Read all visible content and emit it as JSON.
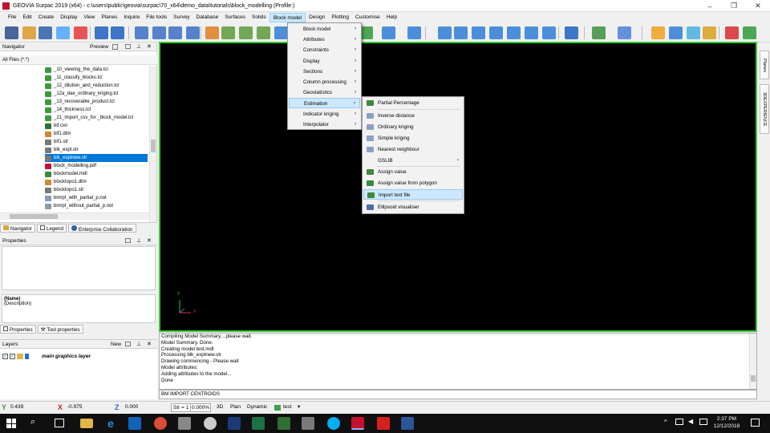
{
  "window": {
    "title": "GEOVIA Surpac 2019 (x64) - c:\\users\\public\\geovia\\surpac\\70_x64\\demo_data\\tutorials\\block_modelling (Profile:)",
    "minimize": "–",
    "maximize": "❐",
    "close": "✕"
  },
  "menubar": [
    "File",
    "Edit",
    "Create",
    "Display",
    "View",
    "Planes",
    "Inquire",
    "File tools",
    "Survey",
    "Database",
    "Surfaces",
    "Solids",
    "Block model",
    "Design",
    "Plotting",
    "Customise",
    "Help"
  ],
  "navigator": {
    "title": "Navigator",
    "preview_label": "Preview",
    "filter": "All Files (*.*)",
    "items": [
      {
        "label": "_10_viewing_the_data.tcl",
        "icon": "tcl-script-icon",
        "selected": false
      },
      {
        "label": "_11_classify_blocks.tcl",
        "icon": "tcl-script-icon",
        "selected": false
      },
      {
        "label": "_12_dilution_and_reduction.tcl",
        "icon": "tcl-script-icon",
        "selected": false
      },
      {
        "label": "_12a_dae_ordinary_kriging.tcl",
        "icon": "tcl-script-icon",
        "selected": false
      },
      {
        "label": "_13_recoverable_product.tcl",
        "icon": "tcl-script-icon",
        "selected": false
      },
      {
        "label": "_14_thickness.tcl",
        "icon": "tcl-script-icon",
        "selected": false
      },
      {
        "label": "_21_import_csv_for _block_model.tcl",
        "icon": "tcl-script-icon",
        "selected": false
      },
      {
        "label": "bif.cxn",
        "icon": "grid-icon",
        "selected": false
      },
      {
        "label": "bif1.dtm",
        "icon": "dtm-icon",
        "selected": false
      },
      {
        "label": "bif1.str",
        "icon": "string-icon",
        "selected": false
      },
      {
        "label": "blk_expt.str",
        "icon": "string-icon",
        "selected": false
      },
      {
        "label": "blk_exptnew.str",
        "icon": "string-icon",
        "selected": true
      },
      {
        "label": "block_modelling.pdf",
        "icon": "pdf-icon",
        "selected": false
      },
      {
        "label": "blockmodel.mdl",
        "icon": "model-icon",
        "selected": false
      },
      {
        "label": "blocktopo1.dtm",
        "icon": "dtm-icon",
        "selected": false
      },
      {
        "label": "blocktopo1.str",
        "icon": "string-icon",
        "selected": false
      },
      {
        "label": "bmrpt_with_partial_p.not",
        "icon": "report-icon",
        "selected": false
      },
      {
        "label": "bmrpt_without_partial_p.not",
        "icon": "report-icon",
        "selected": false
      }
    ],
    "tabs": [
      "Navigator",
      "Legend",
      "Enterprise Collaboration"
    ]
  },
  "properties": {
    "title": "Properties",
    "name_label": "(Name)",
    "desc_label": "(Description)",
    "tabs": [
      "Properties",
      "Tool properties"
    ]
  },
  "layers": {
    "title": "Layers",
    "new_label": "New",
    "layer_name": "main graphics layer"
  },
  "right_tabs": [
    "Planes",
    "3DEXPERIENCE"
  ],
  "viewport": {
    "axis_y": "Y",
    "axis_x": "X"
  },
  "output_lines": [
    "Compiling Model Summary....please wait.",
    "Model Summary. Done.",
    "Creating model test.mdl",
    "Processing blk_exptnew.str",
    "Drawing commencing - Please wait",
    "Model attributes:",
    "Adding attributes to the model...",
    "Done"
  ],
  "command_line": "BM IMPORT CENTROIDS",
  "status": {
    "y_label": "Y",
    "y_value": "0.439",
    "x_label": "X",
    "x_value": "-0.975",
    "z_label": "Z",
    "z_value": "0.000",
    "str_label": "Str = 1",
    "str_value": "0.000%",
    "view_3d": "3D",
    "view_plan": "Plan",
    "mode": "Dynamic",
    "layer": "test"
  },
  "block_model_menu": [
    {
      "label": "Block model",
      "submenu": true
    },
    {
      "label": "Attributes",
      "submenu": true
    },
    {
      "label": "Constraints",
      "submenu": true
    },
    {
      "label": "Display",
      "submenu": true
    },
    {
      "label": "Sections",
      "submenu": true
    },
    {
      "label": "Column processing",
      "submenu": true
    },
    {
      "label": "Geostatistics",
      "submenu": true
    },
    {
      "label": "Estimation",
      "submenu": true,
      "highlighted": true
    },
    {
      "label": "Indicator kriging",
      "submenu": true
    },
    {
      "label": "Interpolator",
      "submenu": true
    }
  ],
  "estimation_menu": [
    {
      "label": "Partial Percentage",
      "icon": "partial-percentage-icon"
    },
    {
      "label": "Inverse distance",
      "icon": "inverse-distance-icon"
    },
    {
      "label": "Ordinary kriging",
      "icon": "ordinary-kriging-icon"
    },
    {
      "label": "Simple kriging",
      "icon": "simple-kriging-icon"
    },
    {
      "label": "Nearest neighbour",
      "icon": "nearest-neighbour-icon"
    },
    {
      "label": "GSLIB",
      "submenu": true
    },
    {
      "label": "Assign value",
      "icon": "assign-value-icon"
    },
    {
      "label": "Assign value from polygon",
      "icon": "assign-polygon-icon"
    },
    {
      "label": "Import text file",
      "icon": "import-text-icon",
      "highlighted": true
    },
    {
      "label": "Ellipsoid visualiser",
      "icon": "ellipsoid-icon"
    }
  ],
  "taskbar": {
    "time": "2:37 PM",
    "date": "12/12/2018"
  },
  "colors": {
    "viewport_bg": "#000000",
    "viewport_border": "#37c837",
    "selection": "#0078d7",
    "menu_highlight": "#cce8ff",
    "taskbar": "#101010"
  }
}
